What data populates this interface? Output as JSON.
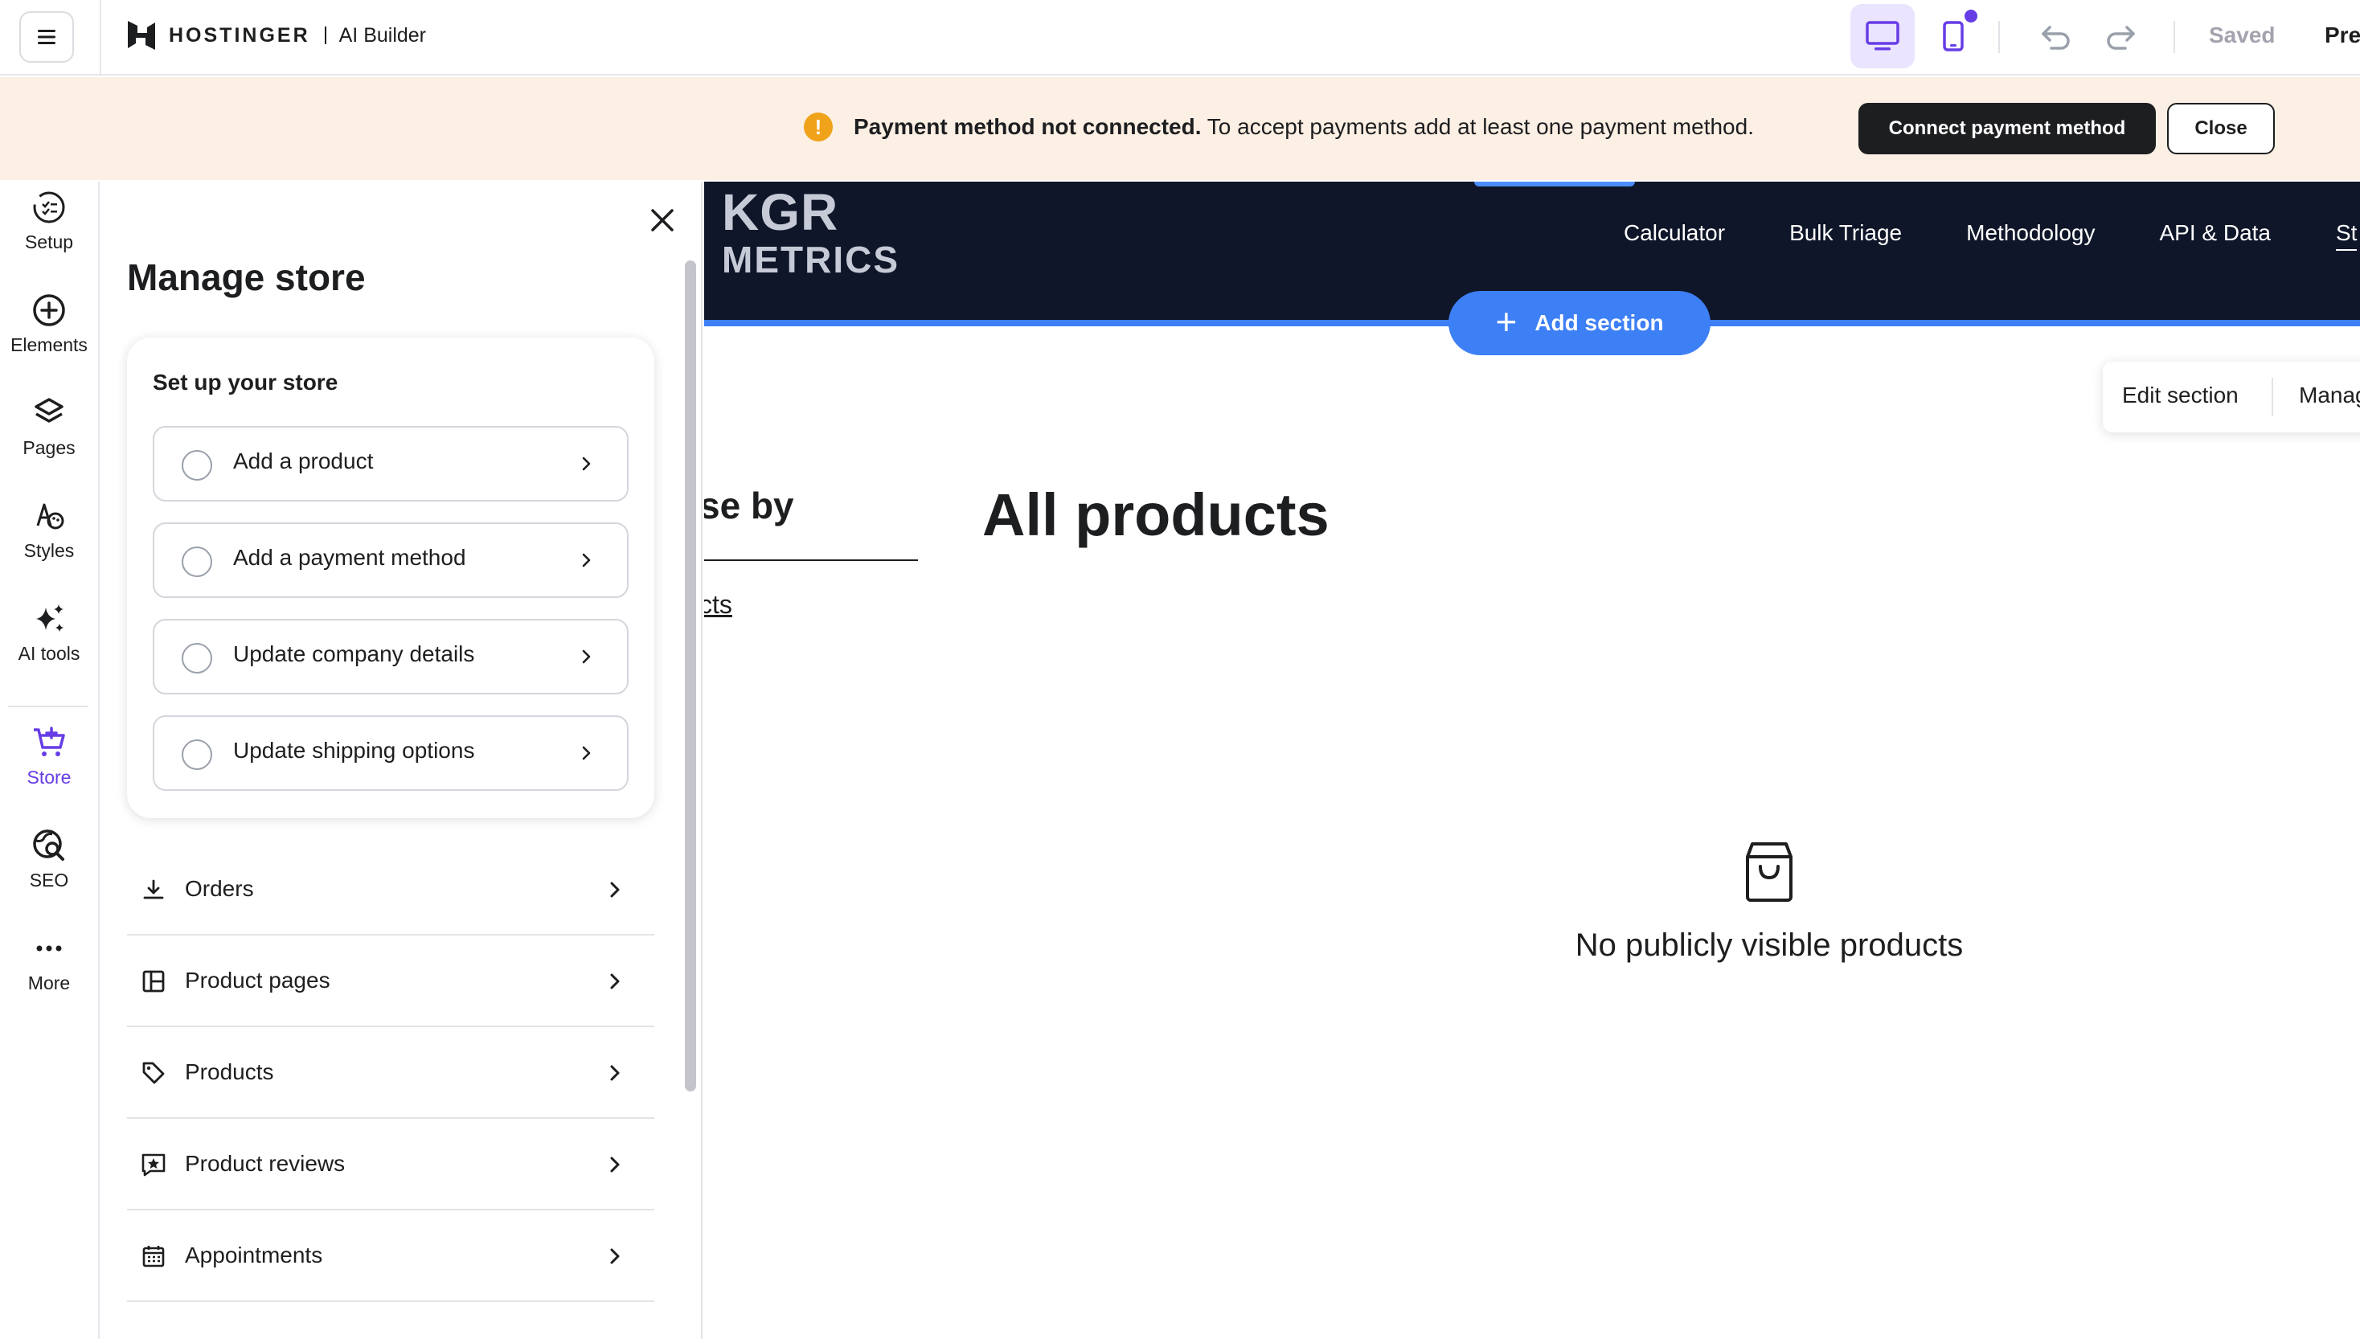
{
  "topbar": {
    "brand": "HOSTINGER",
    "product": "AI Builder",
    "saved_label": "Saved",
    "preview_label": "Pre"
  },
  "banner": {
    "title": "Payment method not connected.",
    "message": "To accept payments add at least one payment method.",
    "connect_label": "Connect payment method",
    "close_label": "Close",
    "warning_glyph": "!"
  },
  "rail": {
    "items": [
      {
        "label": "Setup",
        "icon": "setup-icon"
      },
      {
        "label": "Elements",
        "icon": "plus-circle-icon"
      },
      {
        "label": "Pages",
        "icon": "layers-icon"
      },
      {
        "label": "Styles",
        "icon": "palette-icon"
      },
      {
        "label": "AI tools",
        "icon": "sparkles-icon"
      },
      {
        "label": "Store",
        "icon": "cart-icon",
        "active": true
      },
      {
        "label": "SEO",
        "icon": "globe-search-icon"
      },
      {
        "label": "More",
        "icon": "more-icon"
      }
    ]
  },
  "panel": {
    "title": "Manage store",
    "setup_card": {
      "title": "Set up your store",
      "tasks": [
        {
          "label": "Add a product"
        },
        {
          "label": "Add a payment method"
        },
        {
          "label": "Update company details"
        },
        {
          "label": "Update shipping options"
        }
      ]
    },
    "nav": [
      {
        "label": "Orders",
        "icon": "download-icon"
      },
      {
        "label": "Product pages",
        "icon": "layout-icon"
      },
      {
        "label": "Products",
        "icon": "tag-icon"
      },
      {
        "label": "Product reviews",
        "icon": "star-review-icon"
      },
      {
        "label": "Appointments",
        "icon": "calendar-icon"
      }
    ]
  },
  "site": {
    "logo_line1": "KGR",
    "logo_line2": "METRICS",
    "nav": [
      "Calculator",
      "Bulk Triage",
      "Methodology",
      "API & Data"
    ],
    "nav_cut": "St",
    "add_section_label": "Add section",
    "section_tools": {
      "edit_label": "Edit section",
      "manage_label": "Manage"
    },
    "browse_title": "se by",
    "browse_link": "cts",
    "products_title": "All products",
    "empty_message": "No publicly visible products"
  },
  "colors": {
    "accent": "#673de6",
    "site_header": "#0f1629",
    "site_blue": "#3d7ff5",
    "banner_bg": "#fcefe4",
    "warning": "#f0a31a"
  }
}
